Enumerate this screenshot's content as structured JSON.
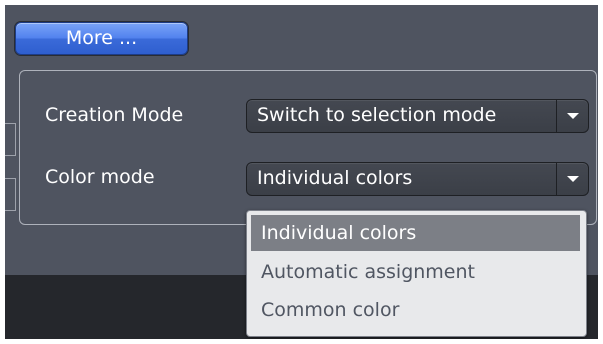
{
  "more_button": {
    "label": "More ..."
  },
  "creation_mode": {
    "label": "Creation Mode",
    "value": "Switch to selection mode"
  },
  "color_mode": {
    "label": "Color mode",
    "value": "Individual colors",
    "options": [
      {
        "label": "Individual colors",
        "selected": true
      },
      {
        "label": "Automatic assignment",
        "selected": false
      },
      {
        "label": "Common color",
        "selected": false
      }
    ]
  },
  "icons": {
    "dropdown_arrow": "chevron-down-icon"
  },
  "colors": {
    "panel_bg": "#4f5460",
    "button_blue": "#5282ee",
    "highlight": "#7c7f86",
    "list_bg": "#e8e9eb"
  }
}
